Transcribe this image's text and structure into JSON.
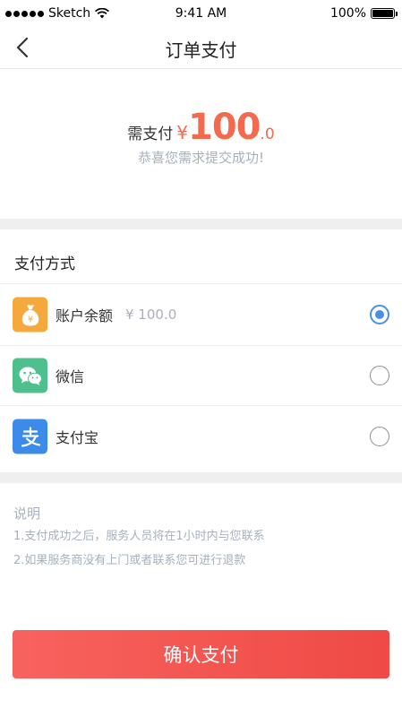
{
  "status_bar": {
    "carrier": "Sketch",
    "time": "9:41 AM",
    "battery_level": "100%"
  },
  "nav": {
    "title": "订单支付"
  },
  "amount": {
    "label": "需支付",
    "currency": "¥",
    "integer": "100",
    "decimal": ".0",
    "success_message": "恭喜您需求提交成功!"
  },
  "payment": {
    "section_title": "支付方式",
    "methods": [
      {
        "label": "账户余额",
        "balance": "¥ 100.0",
        "icon": "money-bag-icon",
        "selected": true
      },
      {
        "label": "微信",
        "icon": "wechat-icon",
        "selected": false
      },
      {
        "label": "支付宝",
        "icon": "alipay-icon",
        "selected": false
      }
    ]
  },
  "notes": {
    "title": "说明",
    "items": [
      "1.支付成功之后，服务人员将在1小时内与您联系",
      "2.如果服务商没有上门或者联系您可进行退款"
    ]
  },
  "confirm_button": "确认支付",
  "colors": {
    "accent": "#f26b4e",
    "button_start": "#f8625e",
    "button_end": "#ef4a45",
    "radio_selected": "#4a90e2",
    "balance_icon_bg": "#f5a83c",
    "wechat_icon_bg": "#4fc08d",
    "alipay_icon_bg": "#3d8be8"
  }
}
